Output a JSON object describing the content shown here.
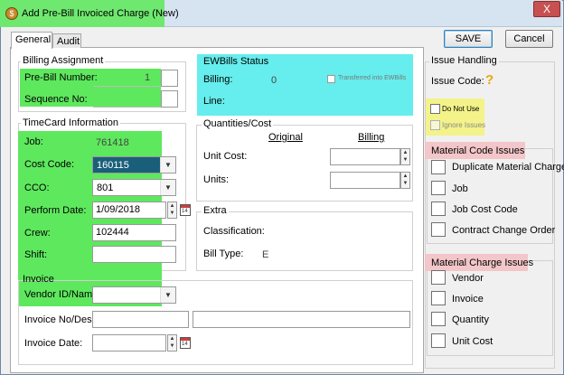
{
  "window": {
    "title": "Add Pre-Bill Invoiced Charge  (New)",
    "close_glyph": "X",
    "icon_glyph": "$"
  },
  "tabs": [
    {
      "label": "General"
    },
    {
      "label": "Audit"
    }
  ],
  "buttons": {
    "save": "SAVE",
    "cancel": "Cancel"
  },
  "billing_assignment": {
    "title": "Billing Assignment",
    "pre_bill_label": "Pre-Bill Number:",
    "pre_bill_value": "1",
    "sequence_label": "Sequence No:",
    "sequence_value": ""
  },
  "ewbills": {
    "title": "EWBills Status",
    "billing_label": "Billing:",
    "billing_value": "0",
    "transferred_label": "Transferred into EWBills",
    "line_label": "Line:"
  },
  "timecard": {
    "title": "TimeCard Information",
    "job_label": "Job:",
    "job_value": "761418",
    "cost_code_label": "Cost Code:",
    "cost_code_value": "160115",
    "cco_label": "CCO:",
    "cco_value": "801",
    "perform_date_label": "Perform Date:",
    "perform_date_value": "1/09/2018",
    "crew_label": "Crew:",
    "crew_value": "102444",
    "shift_label": "Shift:",
    "shift_value": ""
  },
  "quantities": {
    "title": "Quantities/Cost",
    "original_header": "Original",
    "billing_header": "Billing",
    "unit_cost_label": "Unit Cost:",
    "units_label": "Units:"
  },
  "extra": {
    "title": "Extra",
    "classification_label": "Classification:",
    "bill_type_label": "Bill Type:",
    "bill_type_value": "E"
  },
  "invoice": {
    "title": "Invoice",
    "vendor_label": "Vendor ID/Name",
    "vendor_value": "",
    "invoice_no_label": "Invoice No/Desc:",
    "invoice_date_label": "Invoice Date:"
  },
  "issue_handling": {
    "title": "Issue Handling",
    "issue_code_label": "Issue Code:",
    "issue_code_icon": "?",
    "do_not_use_label": "Do Not Use",
    "ignore_issues_label": "Ignore Issues"
  },
  "material_code_issues": {
    "title": "Material Code Issues",
    "items": [
      {
        "label": "Duplicate Material Charge"
      },
      {
        "label": "Job"
      },
      {
        "label": "Job Cost Code"
      },
      {
        "label": "Contract Change Order"
      }
    ]
  },
  "material_charge_issues": {
    "title": "Material Charge Issues",
    "items": [
      {
        "label": "Vendor"
      },
      {
        "label": "Invoice"
      },
      {
        "label": "Quantity"
      },
      {
        "label": "Unit Cost"
      }
    ]
  },
  "colors": {
    "highlight_green": "#5ee85e",
    "highlight_cyan": "#66eded",
    "highlight_yellow": "#f3f38a",
    "highlight_pink": "#f3c6c9",
    "selected_field": "#1a5f7a"
  },
  "icons": {
    "app": "app-dollar-icon",
    "close": "close-icon",
    "dropdown": "chevron-down-icon",
    "spinner": "spinner-icon",
    "calendar": "calendar-icon",
    "help": "question-mark-icon"
  }
}
